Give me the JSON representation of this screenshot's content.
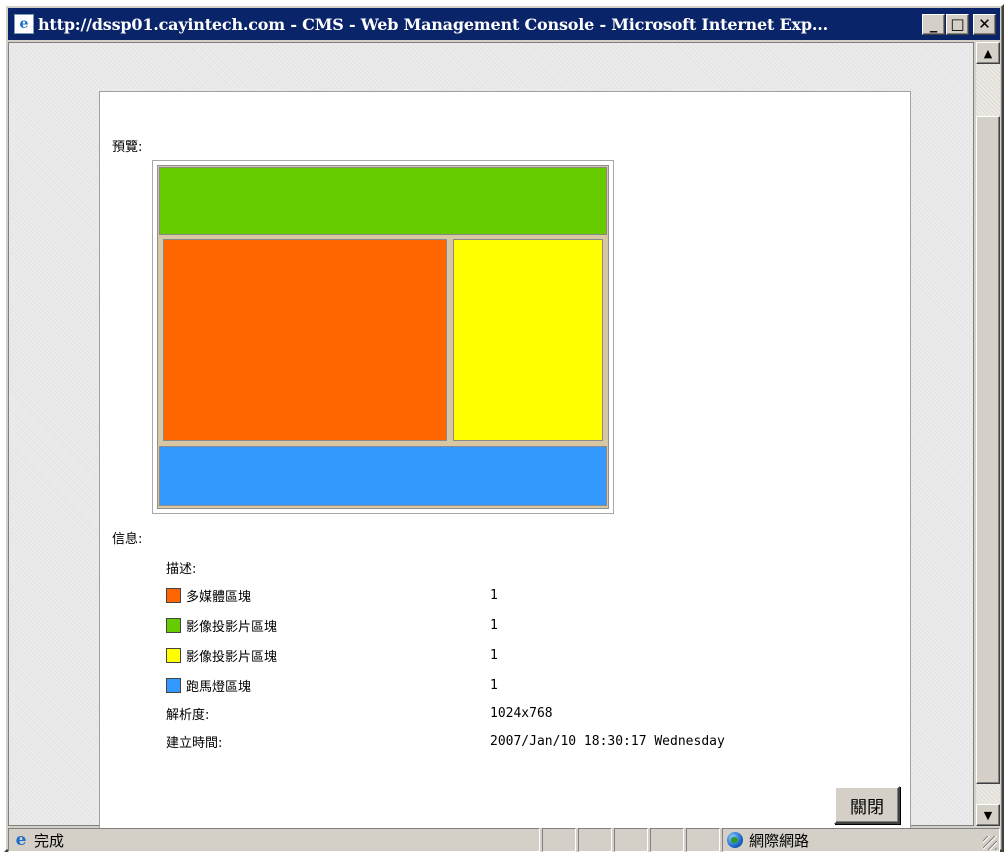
{
  "window": {
    "title": "http://dssp01.cayintech.com - CMS - Web Management Console - Microsoft Internet Exp...",
    "icon": "ie-page-icon",
    "minimize_glyph": "_",
    "maximize_glyph": "□",
    "close_glyph": "✕"
  },
  "page": {
    "preview_label": "預覽:",
    "info_label": "信息:",
    "description_label": "描述:",
    "regions": [
      {
        "label": "多媒體區塊",
        "count": "1",
        "color": "#ff6600"
      },
      {
        "label": "影像投影片區塊",
        "count": "1",
        "color": "#66cc00"
      },
      {
        "label": "影像投影片區塊",
        "count": "1",
        "color": "#ffff00"
      },
      {
        "label": "跑馬燈區塊",
        "count": "1",
        "color": "#3399ff"
      }
    ],
    "resolution_label": "解析度:",
    "resolution_value": "1024x768",
    "created_label": "建立時間:",
    "created_value": "2007/Jan/10 18:30:17 Wednesday",
    "close_button": "關閉"
  },
  "preview_colors": {
    "top_banner": "#66cc00",
    "multimedia": "#ff6600",
    "slideshow_right": "#ffff00",
    "ticker": "#3399ff",
    "frame_background": "#d8c7a3"
  },
  "statusbar": {
    "status_text": "完成",
    "zone_text": "網際網路"
  }
}
